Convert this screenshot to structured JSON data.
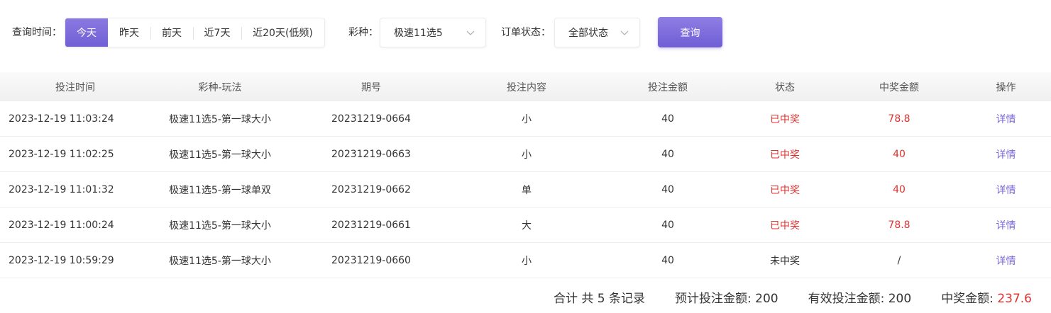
{
  "filters": {
    "time_label": "查询时间：",
    "time_options": [
      "今天",
      "昨天",
      "前天",
      "近7天",
      "近20天(低频)"
    ],
    "time_active_index": 0,
    "lottery_label": "彩种：",
    "lottery_value": "极速11选5",
    "status_label": "订单状态：",
    "status_value": "全部状态",
    "query_button": "查询"
  },
  "table": {
    "headers": [
      "投注时间",
      "彩种-玩法",
      "期号",
      "投注内容",
      "投注金额",
      "状态",
      "中奖金额",
      "操作"
    ],
    "rows": [
      {
        "time": "2023-12-19 11:03:24",
        "play": "极速11选5-第一球大小",
        "issue": "20231219-0664",
        "content": "小",
        "amount": "40",
        "status": "已中奖",
        "win": "78.8",
        "action": "详情",
        "won": true
      },
      {
        "time": "2023-12-19 11:02:25",
        "play": "极速11选5-第一球大小",
        "issue": "20231219-0663",
        "content": "小",
        "amount": "40",
        "status": "已中奖",
        "win": "40",
        "action": "详情",
        "won": true
      },
      {
        "time": "2023-12-19 11:01:32",
        "play": "极速11选5-第一球单双",
        "issue": "20231219-0662",
        "content": "单",
        "amount": "40",
        "status": "已中奖",
        "win": "40",
        "action": "详情",
        "won": true
      },
      {
        "time": "2023-12-19 11:00:24",
        "play": "极速11选5-第一球大小",
        "issue": "20231219-0661",
        "content": "大",
        "amount": "40",
        "status": "已中奖",
        "win": "78.8",
        "action": "详情",
        "won": true
      },
      {
        "time": "2023-12-19 10:59:29",
        "play": "极速11选5-第一球大小",
        "issue": "20231219-0660",
        "content": "小",
        "amount": "40",
        "status": "未中奖",
        "win": "/",
        "action": "详情",
        "won": false
      }
    ]
  },
  "summary": {
    "total": "合计 共 5 条记录",
    "expected_label": "预计投注金额: ",
    "expected_value": "200",
    "effective_label": "有效投注金额: ",
    "effective_value": "200",
    "win_label": "中奖金额: ",
    "win_value": "237.6"
  },
  "colors": {
    "accent": "#7a6ad8",
    "win_red": "#e0322f"
  },
  "icons": {
    "select_arrow": "chevron-down-icon"
  }
}
